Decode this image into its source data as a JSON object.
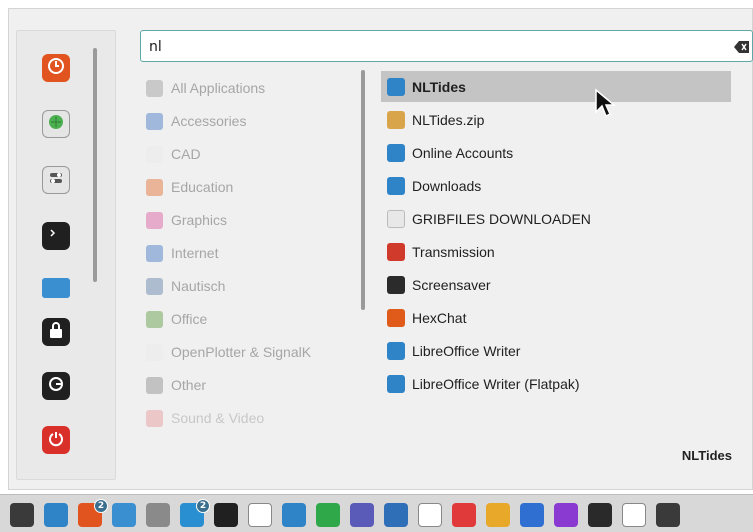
{
  "search": {
    "value": "nl"
  },
  "categories": [
    {
      "label": "All Applications",
      "icon": "grid-icon",
      "color": "#9a9a9a"
    },
    {
      "label": "Accessories",
      "icon": "accessories-icon",
      "color": "#3b73c4"
    },
    {
      "label": "CAD",
      "icon": "cad-icon",
      "color": "#e8e8e8"
    },
    {
      "label": "Education",
      "icon": "education-icon",
      "color": "#e06a2b"
    },
    {
      "label": "Graphics",
      "icon": "graphics-icon",
      "color": "#d9559b"
    },
    {
      "label": "Internet",
      "icon": "internet-icon",
      "color": "#3b73c4"
    },
    {
      "label": "Nautisch",
      "icon": "nautisch-icon",
      "color": "#5b7fa6"
    },
    {
      "label": "Office",
      "icon": "office-icon",
      "color": "#5a9a3b"
    },
    {
      "label": "OpenPlotter & SignalK",
      "icon": "openplotter-icon",
      "color": "#e8e8e8"
    },
    {
      "label": "Other",
      "icon": "other-icon",
      "color": "#8a8a8a"
    },
    {
      "label": "Sound & Video",
      "icon": "sound-video-icon",
      "color": "#e04a4a"
    }
  ],
  "results": [
    {
      "label": "NLTides",
      "icon": "nltides-icon",
      "color": "#2f83c7",
      "selected": true
    },
    {
      "label": "NLTides.zip",
      "icon": "zip-icon",
      "color": "#d9a54a"
    },
    {
      "label": "Online Accounts",
      "icon": "online-accounts-icon",
      "color": "#2f83c7"
    },
    {
      "label": "Downloads",
      "icon": "downloads-folder-icon",
      "color": "#2f83c7"
    },
    {
      "label": "GRIBFILES DOWNLOADEN",
      "icon": "gribfiles-icon",
      "color": "#e8e8e8"
    },
    {
      "label": "Transmission",
      "icon": "transmission-icon",
      "color": "#d03a2a"
    },
    {
      "label": "Screensaver",
      "icon": "screensaver-icon",
      "color": "#2b2b2b"
    },
    {
      "label": "HexChat",
      "icon": "hexchat-icon",
      "color": "#e05a1a"
    },
    {
      "label": "LibreOffice Writer",
      "icon": "libreoffice-writer-icon",
      "color": "#2f83c7"
    },
    {
      "label": "LibreOffice Writer (Flatpak)",
      "icon": "libreoffice-writer-flatpak-icon",
      "color": "#2f83c7"
    }
  ],
  "description": "NLTides",
  "favorites": [
    {
      "name": "firefox-icon",
      "color": "#e2541f"
    },
    {
      "name": "software-manager-icon",
      "color": "#4caf50"
    },
    {
      "name": "settings-icon",
      "color": "#5a5a5a"
    },
    {
      "name": "terminal-icon",
      "color": "#202020"
    },
    {
      "name": "files-icon",
      "color": "#3a8fd1"
    },
    {
      "name": "lock-icon",
      "color": "#202020"
    },
    {
      "name": "logout-icon",
      "color": "#202020"
    },
    {
      "name": "shutdown-icon",
      "color": "#d9302a"
    }
  ],
  "taskbar": {
    "items": [
      {
        "name": "menu-icon",
        "color": "#3a3a3a"
      },
      {
        "name": "show-desktop-icon",
        "color": "#2f83c7"
      },
      {
        "name": "firefox-icon",
        "color": "#e2541f",
        "badge": "2"
      },
      {
        "name": "files-icon",
        "color": "#3a8fd1"
      },
      {
        "name": "search-icon",
        "color": "#8a8a8a"
      },
      {
        "name": "opencpn-icon",
        "color": "#2a8fd1",
        "badge": "2"
      },
      {
        "name": "terminal-icon",
        "color": "#202020"
      },
      {
        "name": "crosshair-icon",
        "color": "#ffffff"
      },
      {
        "name": "notes-icon",
        "color": "#2f83c7"
      },
      {
        "name": "whatsapp-icon",
        "color": "#2fa84a"
      },
      {
        "name": "network-icon",
        "color": "#5a5ab8"
      },
      {
        "name": "vnc-icon",
        "color": "#2f6fb8"
      },
      {
        "name": "x-icon",
        "color": "#ffffff"
      },
      {
        "name": "vivaldi-icon",
        "color": "#e03a3a"
      },
      {
        "name": "chrome-icon",
        "color": "#e8a82a"
      },
      {
        "name": "bluetooth-icon",
        "color": "#2f6fd1"
      },
      {
        "name": "firefox-dev-icon",
        "color": "#8a3ad1"
      },
      {
        "name": "app-orange-icon",
        "color": "#2a2a2a"
      },
      {
        "name": "xcode-icon",
        "color": "#ffffff"
      },
      {
        "name": "app-dark-icon",
        "color": "#3a3a3a"
      }
    ],
    "badge_2": "2"
  }
}
